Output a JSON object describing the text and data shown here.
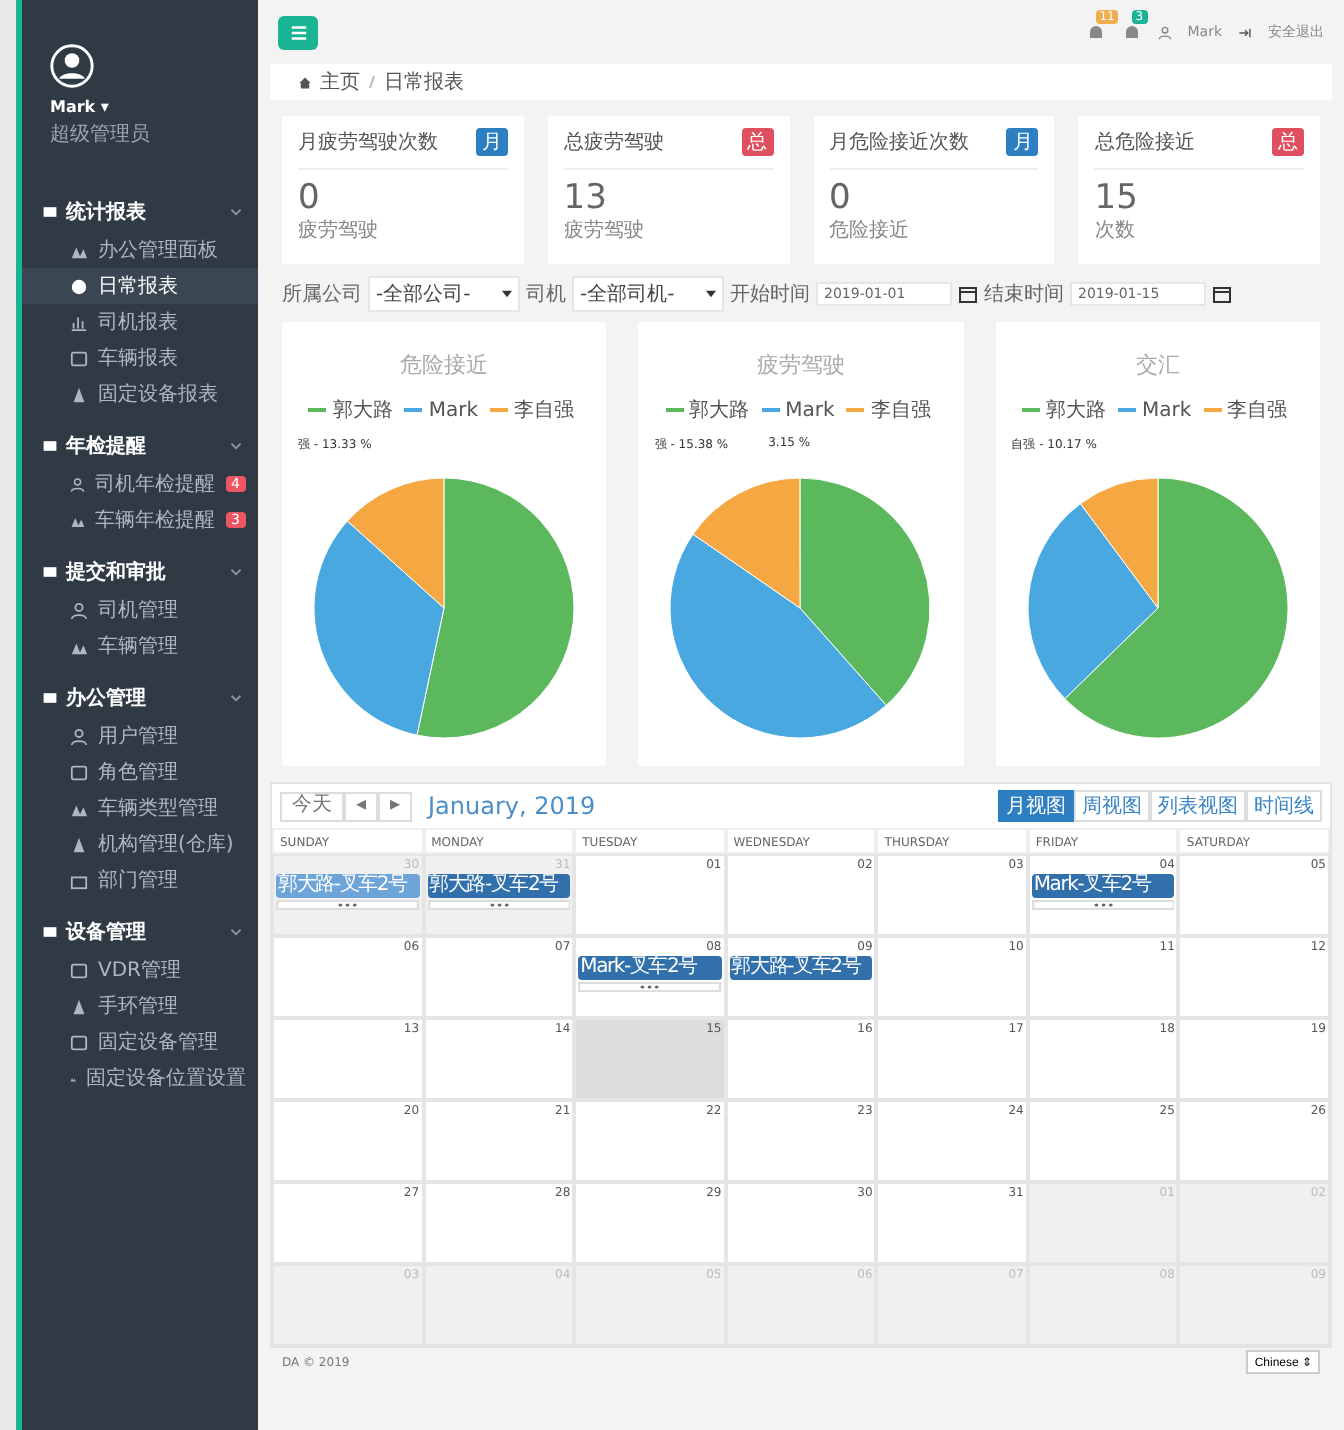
{
  "sidebar": {
    "user": {
      "name": "Mark ▾",
      "role": "超级管理员"
    },
    "groups": [
      {
        "label": "统计报表",
        "expanded": true,
        "items": [
          {
            "label": "办公管理面板",
            "selected": false
          },
          {
            "label": "日常报表",
            "selected": true
          },
          {
            "label": "司机报表",
            "selected": false
          },
          {
            "label": "车辆报表",
            "selected": false
          },
          {
            "label": "固定设备报表",
            "selected": false
          }
        ]
      },
      {
        "label": "年检提醒",
        "expanded": true,
        "items": [
          {
            "label": "司机年检提醒",
            "selected": false,
            "badge": "4"
          },
          {
            "label": "车辆年检提醒",
            "selected": false,
            "badge": "3"
          }
        ]
      },
      {
        "label": "提交和审批",
        "expanded": true,
        "items": [
          {
            "label": "司机管理",
            "selected": false
          },
          {
            "label": "车辆管理",
            "selected": false
          }
        ]
      },
      {
        "label": "办公管理",
        "expanded": true,
        "items": [
          {
            "label": "用户管理",
            "selected": false
          },
          {
            "label": "角色管理",
            "selected": false
          },
          {
            "label": "车辆类型管理",
            "selected": false
          },
          {
            "label": "机构管理(仓库)",
            "selected": false
          },
          {
            "label": "部门管理",
            "selected": false
          }
        ]
      },
      {
        "label": "设备管理",
        "expanded": true,
        "items": [
          {
            "label": "VDR管理",
            "selected": false
          },
          {
            "label": "手环管理",
            "selected": false
          },
          {
            "label": "固定设备管理",
            "selected": false
          },
          {
            "label": "固定设备位置设置",
            "selected": false
          }
        ]
      }
    ]
  },
  "topbar": {
    "alerts": [
      {
        "count": "11",
        "color": "#f0ad4e"
      },
      {
        "count": "3",
        "color": "#1ab394"
      }
    ],
    "user": "Mark",
    "logout": "安全退出"
  },
  "breadcrumb": [
    "主页",
    "日常报表"
  ],
  "cards": [
    {
      "title": "月疲劳驾驶次数",
      "badge": "月",
      "color": "#2d7fc1",
      "value": "0",
      "caption": "疲劳驾驶"
    },
    {
      "title": "总疲劳驾驶",
      "badge": "总",
      "color": "#e04f5f",
      "value": "13",
      "caption": "疲劳驾驶"
    },
    {
      "title": "月危险接近次数",
      "badge": "月",
      "color": "#2d7fc1",
      "value": "0",
      "caption": "危险接近"
    },
    {
      "title": "总危险接近",
      "badge": "总",
      "color": "#e04f5f",
      "value": "15",
      "caption": "次数"
    }
  ],
  "filters": [
    {
      "label": "所属公司",
      "kind": "select",
      "value": "-全部公司-"
    },
    {
      "label": "司机",
      "kind": "select",
      "value": "-全部司机-"
    },
    {
      "label": "开始时间",
      "kind": "date",
      "value": "2019-01-01"
    },
    {
      "label": "结束时间",
      "kind": "date",
      "value": "2019-01-15"
    }
  ],
  "charts": [
    {
      "title": "危险接近",
      "legend": [
        {
          "name": "郭大路",
          "color": "#5cb85c"
        },
        {
          "name": "Mark",
          "color": "#4aa8e0"
        },
        {
          "name": "李自强",
          "color": "#f5a742"
        }
      ],
      "labels": [
        "强 - 13.33 %"
      ]
    },
    {
      "title": "疲劳驾驶",
      "legend": [
        {
          "name": "郭大路",
          "color": "#5cb85c"
        },
        {
          "name": "Mark",
          "color": "#4aa8e0"
        },
        {
          "name": "李自强",
          "color": "#f5a742"
        }
      ],
      "labels": [
        "强 - 15.38 %",
        "3.15 %"
      ]
    },
    {
      "title": "交汇",
      "legend": [
        {
          "name": "郭大路",
          "color": "#5cb85c"
        },
        {
          "name": "Mark",
          "color": "#4aa8e0"
        },
        {
          "name": "李自强",
          "color": "#f5a742"
        }
      ],
      "labels": [
        "自强 - 10.17 %"
      ]
    }
  ],
  "calendar": {
    "today_button": "今天",
    "prev": "◂",
    "next": "▸",
    "title": "January, 2019",
    "views": [
      {
        "label": "月视图",
        "selected": true
      },
      {
        "label": "周视图",
        "selected": false
      },
      {
        "label": "列表视图",
        "selected": false
      },
      {
        "label": "时间线",
        "selected": false
      }
    ],
    "weekdays": [
      "SUNDAY",
      "MONDAY",
      "TUESDAY",
      "WEDNESDAY",
      "THURSDAY",
      "FRIDAY",
      "SATURDAY"
    ],
    "days": [
      {
        "day": "30",
        "other": true,
        "today": false,
        "more": true,
        "events": [
          {
            "text": "郭大路-叉车2号",
            "selected": true
          }
        ]
      },
      {
        "day": "31",
        "other": true,
        "today": false,
        "more": true,
        "events": [
          {
            "text": "郭大路-叉车2号",
            "selected": false
          }
        ]
      },
      {
        "day": "01",
        "other": false,
        "today": false
      },
      {
        "day": "02",
        "other": false,
        "today": false
      },
      {
        "day": "03",
        "other": false,
        "today": false
      },
      {
        "day": "04",
        "other": false,
        "today": false,
        "more": true,
        "events": [
          {
            "text": "Mark-叉车2号",
            "selected": false
          }
        ]
      },
      {
        "day": "05",
        "other": false,
        "today": false
      },
      {
        "day": "06",
        "other": false,
        "today": false
      },
      {
        "day": "07",
        "other": false,
        "today": false
      },
      {
        "day": "08",
        "other": false,
        "today": false,
        "more": true,
        "events": [
          {
            "text": "Mark-叉车2号",
            "selected": false
          }
        ]
      },
      {
        "day": "09",
        "other": false,
        "today": false,
        "events": [
          {
            "text": "郭大路-叉车2号",
            "selected": false
          }
        ]
      },
      {
        "day": "10",
        "other": false,
        "today": false
      },
      {
        "day": "11",
        "other": false,
        "today": false
      },
      {
        "day": "12",
        "other": false,
        "today": false
      },
      {
        "day": "13",
        "other": false,
        "today": false
      },
      {
        "day": "14",
        "other": false,
        "today": false
      },
      {
        "day": "15",
        "other": false,
        "today": true
      },
      {
        "day": "16",
        "other": false,
        "today": false
      },
      {
        "day": "17",
        "other": false,
        "today": false
      },
      {
        "day": "18",
        "other": false,
        "today": false
      },
      {
        "day": "19",
        "other": false,
        "today": false
      },
      {
        "day": "20",
        "other": false,
        "today": false
      },
      {
        "day": "21",
        "other": false,
        "today": false
      },
      {
        "day": "22",
        "other": false,
        "today": false
      },
      {
        "day": "23",
        "other": false,
        "today": false
      },
      {
        "day": "24",
        "other": false,
        "today": false
      },
      {
        "day": "25",
        "other": false,
        "today": false
      },
      {
        "day": "26",
        "other": false,
        "today": false
      },
      {
        "day": "27",
        "other": false,
        "today": false
      },
      {
        "day": "28",
        "other": false,
        "today": false
      },
      {
        "day": "29",
        "other": false,
        "today": false
      },
      {
        "day": "30",
        "other": false,
        "today": false
      },
      {
        "day": "31",
        "other": false,
        "today": false
      },
      {
        "day": "01",
        "other": true,
        "today": false
      },
      {
        "day": "02",
        "other": true,
        "today": false
      },
      {
        "day": "03",
        "other": true,
        "today": false
      },
      {
        "day": "04",
        "other": true,
        "today": false
      },
      {
        "day": "05",
        "other": true,
        "today": false
      },
      {
        "day": "06",
        "other": true,
        "today": false
      },
      {
        "day": "07",
        "other": true,
        "today": false
      },
      {
        "day": "08",
        "other": true,
        "today": false
      },
      {
        "day": "09",
        "other": true,
        "today": false
      }
    ]
  },
  "footer": {
    "copyright": "DA © 2019",
    "language": "Chinese ⇕"
  }
}
